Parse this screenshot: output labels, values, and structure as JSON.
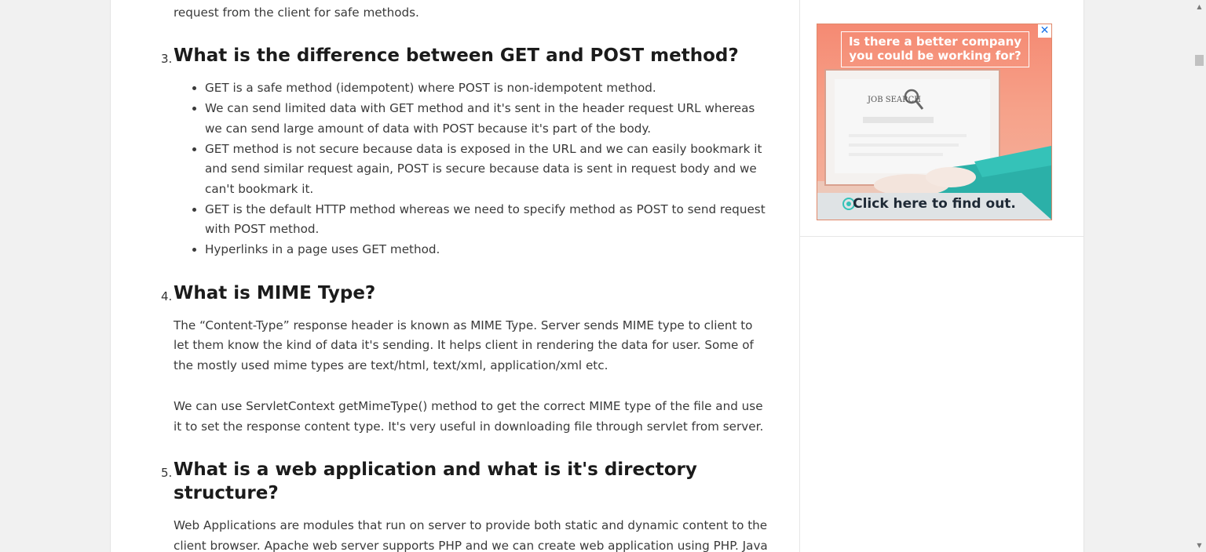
{
  "intro_tail": "idempotent methods are also known as safe methods and we don't care about the repetitive request from the client for safe methods.",
  "sections": [
    {
      "number": "3.",
      "title": "What is the difference between GET and POST method?",
      "bullets": [
        "GET is a safe method (idempotent) where POST is non-idempotent method.",
        "We can send limited data with GET method and it's sent in the header request URL whereas we can send large amount of data with POST because it's part of the body.",
        "GET method is not secure because data is exposed in the URL and we can easily bookmark it and send similar request again, POST is secure because data is sent in request body and we can't bookmark it.",
        "GET is the default HTTP method whereas we need to specify method as POST to send request with POST method.",
        "Hyperlinks in a page uses GET method."
      ]
    },
    {
      "number": "4.",
      "title": "What is MIME Type?",
      "paragraphs": [
        "The “Content-Type” response header is known as MIME Type. Server sends MIME type to client to let them know the kind of data it's sending. It helps client in rendering the data for user. Some of the mostly used mime types are text/html, text/xml, application/xml etc.",
        "We can use ServletContext getMimeType() method to get the correct MIME type of the file and use it to set the response content type. It's very useful in downloading file through servlet from server."
      ]
    },
    {
      "number": "5.",
      "title": "What is a web application and what is it's directory structure?",
      "paragraphs": [
        "Web Applications are modules that run on server to provide both static and dynamic content to the client browser. Apache web server supports PHP and we can create web application using PHP. Java provides web application support through Servlets and JSPs that can run in a servlet container and"
      ]
    }
  ],
  "ad": {
    "headline": "Is there a better company you could be working for?",
    "cta": "Click here to find out.",
    "screen_text": "JOB SEARCH",
    "close_icon": "✕",
    "colors": {
      "background": "#f58a73",
      "laptop": "#2bb0a8"
    }
  },
  "scrollbar": {
    "up_arrow": "▲",
    "down_arrow": "▼"
  }
}
